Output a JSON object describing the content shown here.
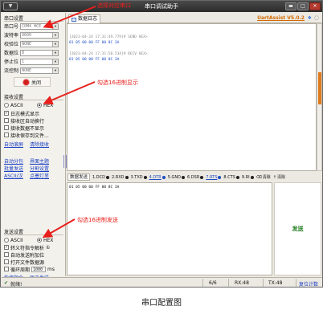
{
  "window": {
    "title": "串口调试助手",
    "logo_text": "▼",
    "buttons": [
      "▬",
      "□",
      "✕"
    ]
  },
  "serial_settings": {
    "group_title": "串口设置",
    "rows": [
      {
        "label": "串口号",
        "value": "COM4 HCE"
      },
      {
        "label": "波特率",
        "value": "9600"
      },
      {
        "label": "校验位",
        "value": "NONE"
      },
      {
        "label": "数据位",
        "value": "8"
      },
      {
        "label": "停止位",
        "value": "1"
      },
      {
        "label": "流控制",
        "value": "NONE"
      }
    ],
    "close_button": "关闭"
  },
  "receive_settings": {
    "group_title": "接收设置",
    "mode_ascii": "ASCII",
    "mode_hex": "HEX",
    "checks": [
      {
        "label": "日志模式显示",
        "checked": true
      },
      {
        "label": "接收区自动换行",
        "checked": false
      },
      {
        "label": "接收数据不显示",
        "checked": false
      },
      {
        "label": "接收保存到文件...",
        "checked": false
      }
    ],
    "links": [
      "自动滚屏",
      "清除接收"
    ]
  },
  "tools": {
    "links": [
      "自动分包",
      "界面主题",
      "批量发送",
      "分割设置",
      "ASCII/汉",
      "点塞灯里"
    ]
  },
  "send_settings": {
    "group_title": "发送设置",
    "mode_ascii": "ASCII",
    "mode_hex": "HEX",
    "checks": [
      {
        "label": "转义符指令解析",
        "checked": true,
        "hint": "①"
      },
      {
        "label": "自动发送附加位",
        "checked": false
      },
      {
        "label": "打开文件数据源",
        "checked": false
      },
      {
        "label": "循环周期",
        "checked": false
      }
    ],
    "interval_value": "1000",
    "interval_unit": "ms",
    "links": [
      "快捷指令",
      "历史发送"
    ]
  },
  "tab": {
    "label": "数据日志",
    "version": "UartAssist V5.0.2",
    "icon1": "❖",
    "icon2": "◌"
  },
  "receive_log": [
    {
      "text": "[2023-04-24 17:31:49.779]# SEND HEX>",
      "style": "gray"
    },
    {
      "text": "01 05 00 00 FF 00 8C 3A",
      "style": "blue"
    },
    {
      "text": "",
      "style": "gray"
    },
    {
      "text": "[2023-04-24 17:31:50.534]# RECV HEX>",
      "style": "gray"
    },
    {
      "text": "01 05 00 00 FF 00 8C 3A",
      "style": "blue"
    }
  ],
  "send_bar": {
    "title": "数据发送",
    "signals": [
      {
        "label": "1.DCD",
        "underline": false
      },
      {
        "label": "2.RXD",
        "underline": false
      },
      {
        "label": "3.TXD",
        "underline": false
      },
      {
        "label": "4.DTR",
        "underline": true
      },
      {
        "label": "5.GND",
        "underline": false
      },
      {
        "label": "6.DSR",
        "underline": false
      },
      {
        "label": "7.RTS",
        "underline": true
      },
      {
        "label": "8.CTS",
        "underline": false
      },
      {
        "label": "9.RI",
        "underline": false
      }
    ],
    "clear_send": "清除",
    "clear_all": "清除"
  },
  "send_area": {
    "content": "01 05 00 00 FF 00 8C 3A",
    "send_button": "发送"
  },
  "status_bar": {
    "state": "就绪!",
    "counter": "6/6",
    "rx": "RX:48",
    "tx": "TX:48",
    "reset": "复位计数"
  },
  "annotations": {
    "select_port": "选择对应串口",
    "hex_display": "勾选16进制显示",
    "hex_send": "勾选16进制发送"
  },
  "caption": "串口配置图",
  "colors": {
    "annotation": "#e8201c",
    "link": "#1a3fc4",
    "version": "#d46a00",
    "send_text": "#1a7a1a"
  }
}
